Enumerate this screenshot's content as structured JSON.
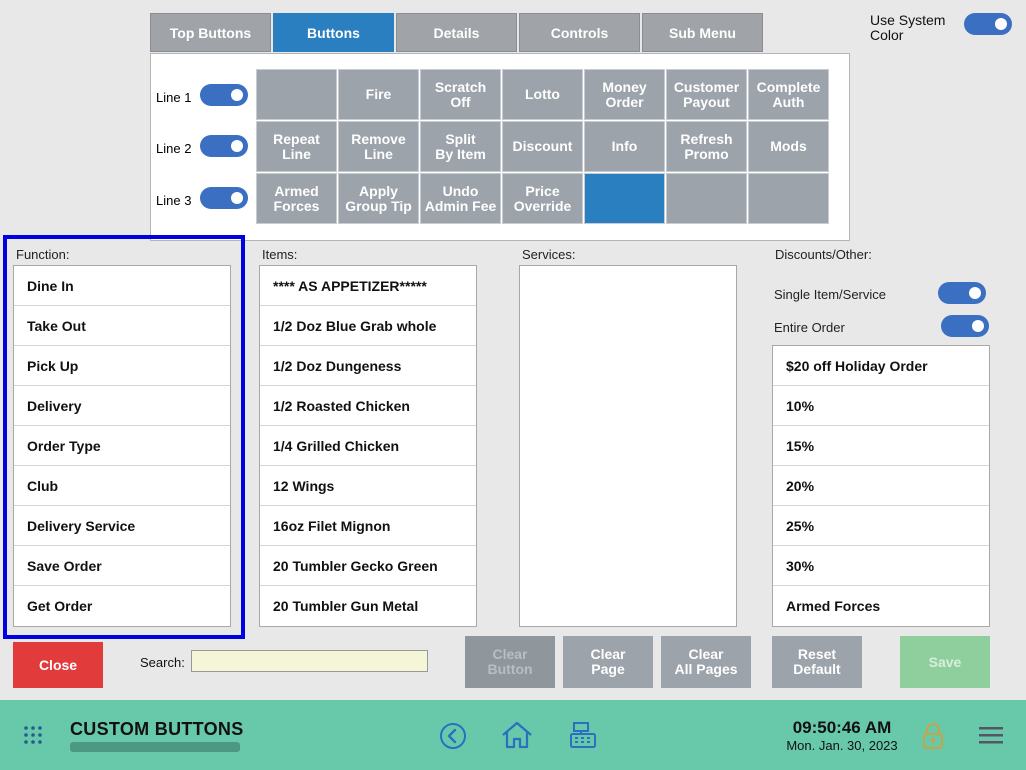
{
  "tabs": [
    "Top Buttons",
    "Buttons",
    "Details",
    "Controls",
    "Sub Menu"
  ],
  "use_system_color": {
    "label_line1": "Use System",
    "label_line2": "Color",
    "on": true
  },
  "lines": [
    "Line 1",
    "Line 2",
    "Line 3"
  ],
  "grid": [
    [
      "",
      "Fire",
      "Scratch\nOff",
      "Lotto",
      "Money\nOrder",
      "Customer\nPayout",
      "Complete\nAuth"
    ],
    [
      "Repeat\nLine",
      "Remove\nLine",
      "Split\nBy Item",
      "Discount",
      "Info",
      "Refresh\nPromo",
      "Mods"
    ],
    [
      "Armed\nForces",
      "Apply\nGroup Tip",
      "Undo\nAdmin Fee",
      "Price\nOverride",
      "",
      "",
      ""
    ]
  ],
  "function": {
    "label": "Function:",
    "items": [
      "Dine In",
      "Take Out",
      "Pick Up",
      "Delivery",
      "Order Type",
      "Club",
      "Delivery Service",
      "Save Order",
      "Get Order"
    ]
  },
  "items": {
    "label": "Items:",
    "items": [
      "**** AS APPETIZER*****",
      "1/2 Doz Blue Grab whole",
      "1/2 Doz Dungeness",
      "1/2 Roasted Chicken",
      "1/4 Grilled Chicken",
      "12 Wings",
      "16oz Filet Mignon",
      "20 Tumbler Gecko Green",
      "20 Tumbler Gun Metal"
    ]
  },
  "services": {
    "label": "Services:",
    "items": []
  },
  "discounts": {
    "label": "Discounts/Other:",
    "single_item_label": "Single Item/Service",
    "entire_order_label": "Entire Order",
    "items": [
      "$20 off Holiday Order",
      "10%",
      "15%",
      "20%",
      "25%",
      "30%",
      "Armed Forces"
    ]
  },
  "buttons": {
    "close": "Close",
    "search_label": "Search:",
    "search_value": "",
    "clear_button": "Clear\nButton",
    "clear_page": "Clear\nPage",
    "clear_all_pages": "Clear\nAll Pages",
    "reset_default": "Reset\nDefault",
    "save": "Save"
  },
  "footer": {
    "title": "CUSTOM BUTTONS",
    "time": "09:50:46 AM",
    "date": "Mon. Jan. 30, 2023"
  },
  "colors": {
    "accent": "#2a7fc0",
    "toggle": "#3a6fc2",
    "close": "#e23b3b",
    "save": "#8fcf9e",
    "footer": "#67c9aa",
    "highlight": "#0000e0"
  }
}
